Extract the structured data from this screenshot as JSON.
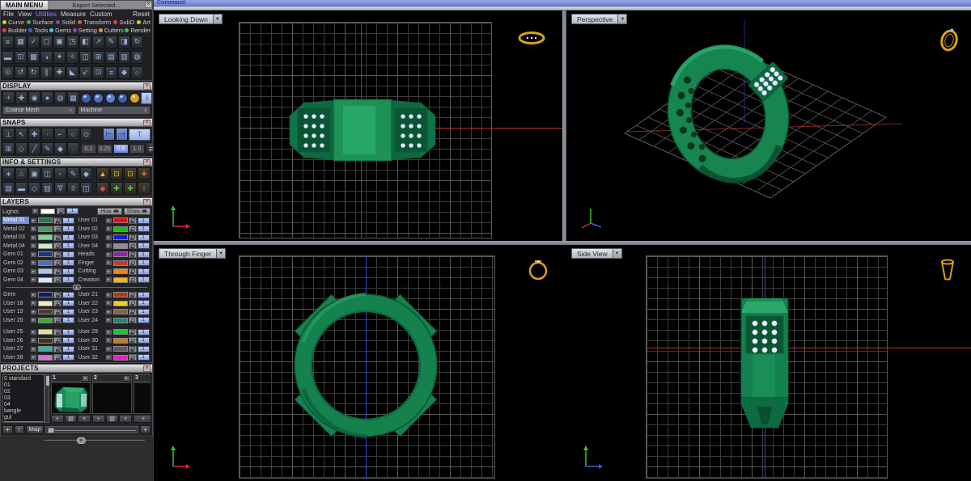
{
  "command_bar": {
    "label": "Command:"
  },
  "main_menu": {
    "title": "MAIN MENU",
    "export_label": "Export Selected...",
    "close_glyph": "×",
    "items": [
      {
        "label": "File"
      },
      {
        "label": "View"
      },
      {
        "label": "Utilities",
        "color": "#8c86ff"
      },
      {
        "label": "Measure"
      },
      {
        "label": "Custom"
      },
      {
        "label": "Reset",
        "right": true
      }
    ],
    "categories_row1": [
      {
        "label": "Curve",
        "dot": "#d6d23e"
      },
      {
        "label": "Surface",
        "dot": "#3eae7e"
      },
      {
        "label": "Solid",
        "dot": "#8e3ec6"
      },
      {
        "label": "Transform",
        "dot": "#e2603e"
      },
      {
        "label": "SubD",
        "dot": "#e23e3e"
      },
      {
        "label": "Art",
        "dot": "#c2d23e"
      }
    ],
    "categories_row2": [
      {
        "label": "Builder",
        "dot": "#e23e3e"
      },
      {
        "label": "Tools",
        "dot": "#3e62e2"
      },
      {
        "label": "Gems",
        "dot": "#55c8e0"
      },
      {
        "label": "Setting",
        "dot": "#a23ec6"
      },
      {
        "label": "Cutters",
        "dot": "#e2943e"
      },
      {
        "label": "Render",
        "dot": "#3ec262"
      }
    ]
  },
  "toolbars": {
    "row1": [
      "≡",
      "▦",
      "✓",
      "▢",
      "▣",
      "◳",
      "◧",
      "↗",
      "✎",
      "◨",
      "↻"
    ],
    "row2": [
      "▬",
      "⊡",
      "▩",
      "◑",
      "✦",
      "✧",
      "◫",
      "⊞",
      "▤",
      "▥",
      "◍"
    ],
    "row3": [
      "⊙",
      "↺",
      "↻",
      "∥",
      "✚",
      "◣",
      "↙",
      "⊡",
      "≡",
      "◆",
      "○"
    ]
  },
  "display": {
    "title": "DISPLAY",
    "close_glyph": "×",
    "icons": [
      "+",
      "✚",
      "◉",
      "●",
      "◍",
      "▦"
    ],
    "spheres": [
      {
        "c": "#3a5fae"
      },
      {
        "c": "#4a6fbe"
      },
      {
        "c": "#5a7fd0"
      },
      {
        "c": "#3a5fae"
      },
      {
        "c": "#d8a020"
      }
    ],
    "tall_glyph": "|",
    "mesh_mode": "Coarse Mesh",
    "machine_mode": "Machine",
    "caret": "∨"
  },
  "snaps": {
    "title": "SNAPS",
    "close_glyph": "×",
    "row1": [
      "⊥",
      "↖",
      "✚",
      "·",
      "⌐",
      "○",
      "⊙"
    ],
    "row1_toggles": [
      "⊢",
      "⊣"
    ],
    "big_glyph": "⊤",
    "row2": [
      "⊞",
      "◇",
      "╱",
      "✎",
      "◆",
      "·"
    ],
    "values": [
      {
        "v": "0.1"
      },
      {
        "v": "0.25"
      },
      {
        "v": "0.5",
        "selected": true
      },
      {
        "v": "1.0"
      }
    ],
    "end_glyph": "⇄"
  },
  "info": {
    "title": "INFO & SETTINGS",
    "close_glyph": "×",
    "row1": [
      "∗",
      "⌂",
      "▣",
      "◫",
      "▫",
      "✎",
      "◆"
    ],
    "row1_colored": [
      {
        "g": "▲",
        "c": "#e0c030"
      },
      {
        "g": "⊡",
        "c": "#e0c030"
      },
      {
        "g": "⊡",
        "c": "#e0c030"
      },
      {
        "g": "✚",
        "c": "#e05858"
      }
    ],
    "row2": [
      "▤",
      "▬",
      "◇",
      "▥",
      "∇",
      "◊",
      "◫"
    ],
    "row2_colored": [
      {
        "g": "◆",
        "c": "#c85454"
      },
      {
        "g": "✚",
        "c": "#54c854"
      },
      {
        "g": "✚",
        "c": "#54c854"
      },
      {
        "g": "↕",
        "c": "#8a9ae4"
      }
    ]
  },
  "layers": {
    "title": "LAYERS",
    "close_glyph": "×",
    "lights_label": "Lights",
    "lights_color": "#ffffff",
    "hide_label": "Hide",
    "show_label": "Show",
    "expand_glyph": "▸",
    "one_label": "1",
    "top_left": [
      {
        "name": "Metal 01",
        "color": "#1b7a4b",
        "selected": true
      },
      {
        "name": "Metal 02",
        "color": "#3f9e5f"
      },
      {
        "name": "Metal 03",
        "color": "#84d294"
      },
      {
        "name": "Metal 04",
        "color": "#c9ecca"
      },
      {
        "name": "Gem 01",
        "color": "#16377f"
      },
      {
        "name": "Gem 02",
        "color": "#4a6fc2"
      },
      {
        "name": "Gem 03",
        "color": "#a9c9ee"
      },
      {
        "name": "Gem 04",
        "color": "#d9e7f8"
      }
    ],
    "top_right": [
      {
        "name": "User 01",
        "color": "#e01212"
      },
      {
        "name": "User 02",
        "color": "#12c012"
      },
      {
        "name": "User 03",
        "color": "#1a1ad8"
      },
      {
        "name": "User 04",
        "color": "#8f8f8f"
      },
      {
        "name": "Heads",
        "color": "#8b2ba2"
      },
      {
        "name": "Finger",
        "color": "#c23a30"
      },
      {
        "name": "Cutting",
        "color": "#f08414"
      },
      {
        "name": "Creation",
        "color": "#f2b51f"
      }
    ],
    "bottom_left": [
      {
        "name": "Gem",
        "color": "#101a60"
      },
      {
        "name": "User 18",
        "color": "#f2ecb5"
      },
      {
        "name": "User 19",
        "color": "#4d3b29"
      },
      {
        "name": "User 20",
        "color": "#35b224"
      },
      {
        "name": "User 25",
        "color": "#dde492",
        "gap": true
      },
      {
        "name": "User 26",
        "color": "#3c3619"
      },
      {
        "name": "User 27",
        "color": "#35b2a2"
      },
      {
        "name": "User 28",
        "color": "#d473d4"
      }
    ],
    "bottom_right": [
      {
        "name": "User 21",
        "color": "#a24312"
      },
      {
        "name": "User 22",
        "color": "#e8d322"
      },
      {
        "name": "User 23",
        "color": "#85643f"
      },
      {
        "name": "User 24",
        "color": "#2b8273"
      },
      {
        "name": "User 29",
        "color": "#22c232",
        "gap": true
      },
      {
        "name": "User 30",
        "color": "#c47b2a"
      },
      {
        "name": "User 31",
        "color": "#5a5a5a"
      },
      {
        "name": "User 32",
        "color": "#e222c2"
      }
    ]
  },
  "projects": {
    "title": "PROJECTS",
    "close_glyph": "×",
    "list": [
      {
        "label": "0 standard"
      },
      {
        "label": "01"
      },
      {
        "label": "02"
      },
      {
        "label": "03"
      },
      {
        "label": "04"
      },
      {
        "label": "bangle"
      },
      {
        "label": "gul"
      },
      {
        "label": "",
        "selected": true
      }
    ],
    "slots": [
      {
        "n": "1"
      },
      {
        "n": "2"
      },
      {
        "n": "3"
      }
    ],
    "slot_expand": "▸",
    "add_glyph": "+",
    "save_glyph": "▤",
    "del_glyph": "×",
    "up_glyph": "↑",
    "mngr_label": "Magr",
    "plus_glyph": "+"
  },
  "viewports": [
    {
      "label": "Looking Down"
    },
    {
      "label": "Perspective"
    },
    {
      "label": "Through Finger"
    },
    {
      "label": "Side View"
    }
  ],
  "viewport_ui": {
    "caret": "▼"
  }
}
